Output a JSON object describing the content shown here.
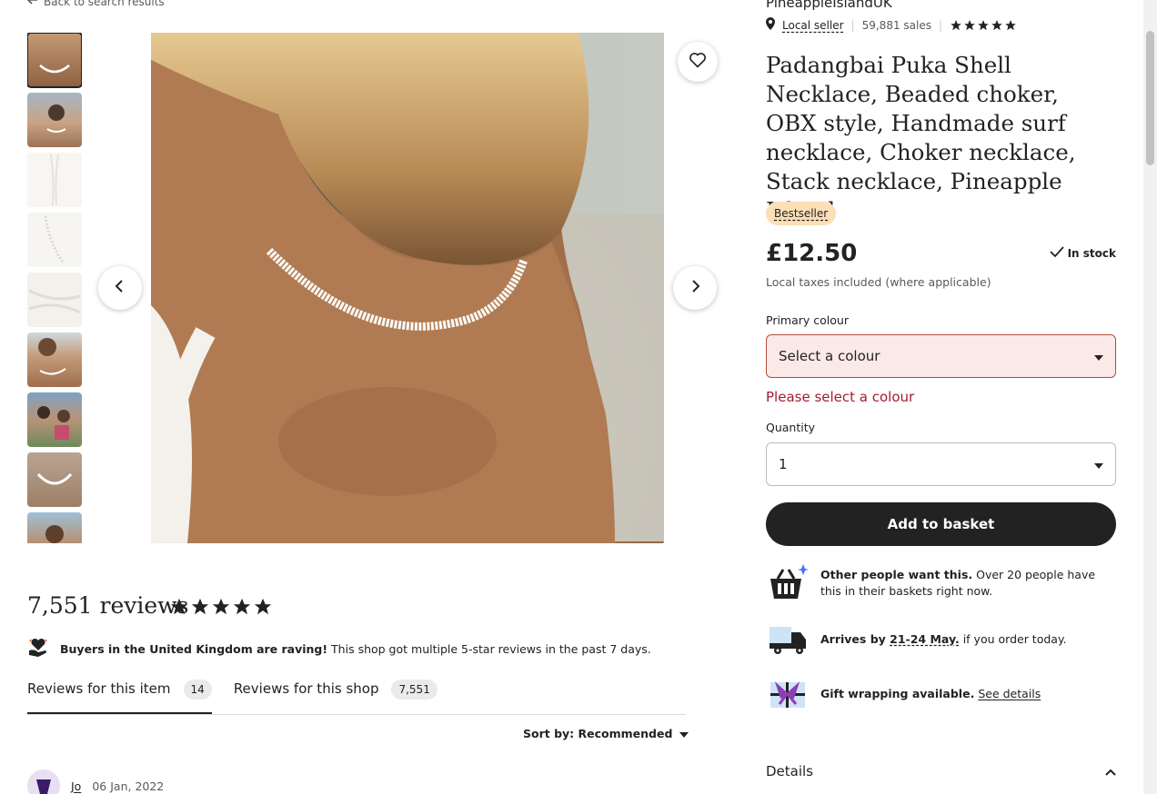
{
  "nav": {
    "back_label": "Back to search results"
  },
  "gallery": {
    "thumbnails": [
      "thumb-1",
      "thumb-2",
      "thumb-3",
      "thumb-4",
      "thumb-5",
      "thumb-6",
      "thumb-7",
      "thumb-8",
      "thumb-9"
    ],
    "active_index": 0
  },
  "shop": {
    "name": "PineappleIslandUK",
    "local_seller_label": "Local seller",
    "sales": "59,881 sales",
    "rating_stars": 5
  },
  "product": {
    "title": "Padangbai Puka Shell Necklace, Beaded choker, OBX style, Handmade surf necklace, Choker necklace, Stack necklace, Pineapple Island",
    "badge": "Bestseller",
    "price": "£12.50",
    "stock": "In stock",
    "tax_note": "Local taxes included (where applicable)"
  },
  "form": {
    "colour_label": "Primary colour",
    "colour_value": "Select a colour",
    "colour_error": "Please select a colour",
    "quantity_label": "Quantity",
    "quantity_value": "1",
    "add_to_basket": "Add to basket"
  },
  "highlights": {
    "demand_bold": "Other people want this.",
    "demand_text": " Over 20 people have this in their baskets right now.",
    "arrives_prefix": "Arrives by ",
    "arrives_date": "21-24 May.",
    "arrives_suffix": " if you order today.",
    "gift_bold": "Gift wrapping available.",
    "gift_link": "See details"
  },
  "details": {
    "label": "Details"
  },
  "reviews": {
    "count_label": "7,551 reviews",
    "rating_stars": 5,
    "raving_bold": "Buyers in the United Kingdom are raving!",
    "raving_text": " This shop got multiple 5-star reviews in the past 7 days.",
    "tab_item_label": "Reviews for this item",
    "tab_item_count": "14",
    "tab_shop_label": "Reviews for this shop",
    "tab_shop_count": "7,551",
    "sort_label": "Sort by: Recommended",
    "first_reviewer": "Jo",
    "first_date": "06 Jan, 2022"
  },
  "colors": {
    "accent_dark": "#222222",
    "error_red": "#a61a2e",
    "badge_bg": "#fcdfb6"
  }
}
